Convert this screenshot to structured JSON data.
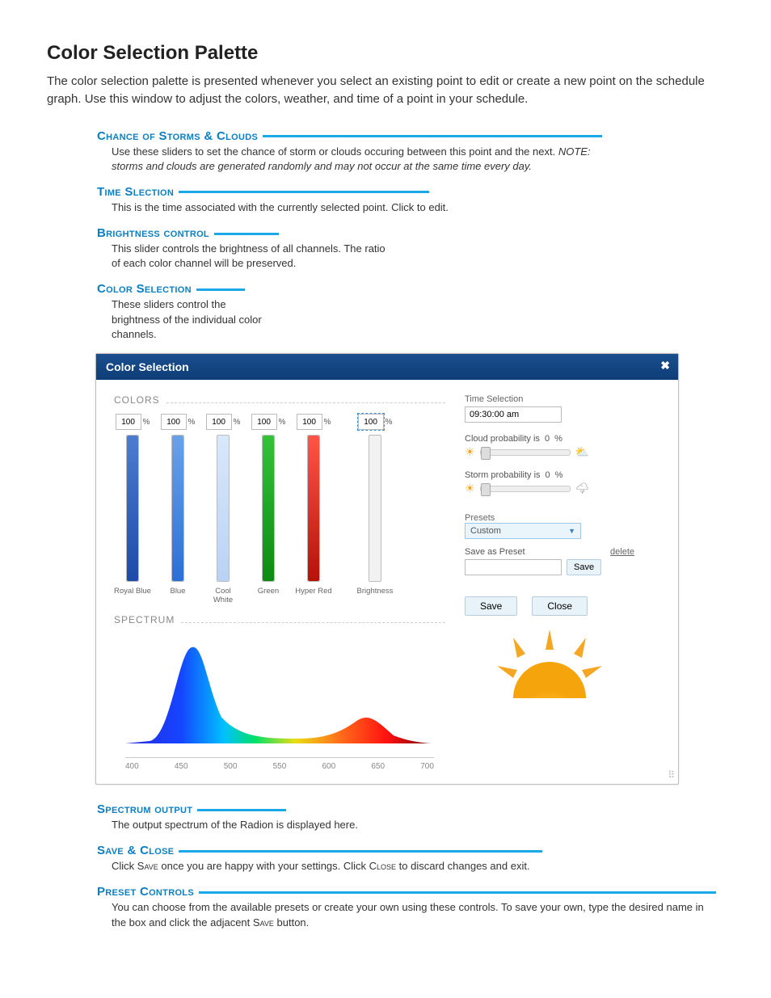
{
  "page": {
    "title": "Color Selection Palette",
    "intro": "The color selection palette is presented whenever you select an existing point to edit or create a new point on the schedule graph. Use this window to adjust the colors, weather, and time of a point in your schedule."
  },
  "callouts": {
    "storms": {
      "heading": "Chance of Storms & Clouds",
      "body_a": "Use these sliders to set the chance of storm or clouds occuring between this point and the next. ",
      "note_label": "NOTE: ",
      "note_body": "storms and clouds are generated randomly and may not occur at the same time every day."
    },
    "time": {
      "heading": "Time Slection",
      "body": "This is the time associated with the currently selected point. Click to edit."
    },
    "brightness": {
      "heading": "Brightness control",
      "body": "This slider controls the brightness of all channels. The ratio of each color channel will be preserved."
    },
    "colorsel": {
      "heading": "Color Selection",
      "body": "These sliders control the brightness of the individual color channels."
    },
    "spectrum": {
      "heading": "Spectrum output",
      "body": "The output spectrum of the Radion is displayed here."
    },
    "saveclose": {
      "heading": "Save & Close",
      "body_a": "Click ",
      "save_word": "Save",
      "body_b": " once you are happy with your settings. Click ",
      "close_word": "Close",
      "body_c": " to discard changes and exit."
    },
    "presets": {
      "heading": "Preset Controls",
      "body_a": "You can choose from the available presets or create your own using these controls. To save your own, type the desired name in the box and click the adjacent ",
      "save_word": "Save",
      "body_b": " button."
    }
  },
  "dialog": {
    "title": "Color Selection",
    "colors_label": "COLORS",
    "spectrum_label": "SPECTRUM",
    "percent": "%",
    "channels": [
      {
        "name": "Royal Blue",
        "value": "100",
        "css": "linear-gradient(#4d7ccf,#1e4aa8)"
      },
      {
        "name": "Blue",
        "value": "100",
        "css": "linear-gradient(#6aa2e8,#2b6fd6)"
      },
      {
        "name": "Cool White",
        "value": "100",
        "css": "linear-gradient(#d9e8fb,#b9d2f4)"
      },
      {
        "name": "Green",
        "value": "100",
        "css": "linear-gradient(#34c23a,#0c8a12)"
      },
      {
        "name": "Hyper Red",
        "value": "100",
        "css": "linear-gradient(#ff5547,#b51209)"
      }
    ],
    "brightness": {
      "label": "Brightness",
      "value": "100"
    },
    "spectrum_ticks": [
      "400",
      "450",
      "500",
      "550",
      "600",
      "650",
      "700"
    ],
    "time_section": {
      "label": "Time Selection",
      "value": "09:30:00 am"
    },
    "cloud": {
      "label_a": "Cloud probability is",
      "value": "0",
      "unit": "%"
    },
    "storm": {
      "label_a": "Storm probability is",
      "value": "0",
      "unit": "%"
    },
    "presets": {
      "label": "Presets",
      "selected": "Custom"
    },
    "saveas": {
      "label": "Save as Preset",
      "delete": "delete",
      "save": "Save"
    },
    "actions": {
      "save": "Save",
      "close": "Close"
    }
  }
}
